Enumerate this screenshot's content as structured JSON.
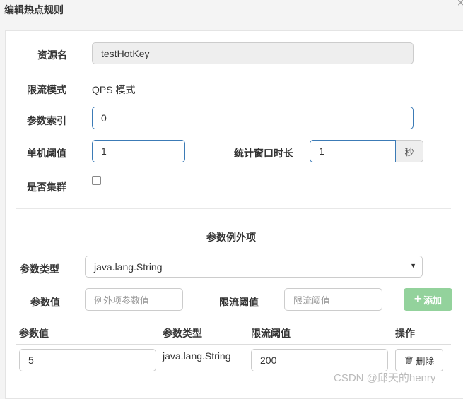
{
  "dialog": {
    "title": "编辑热点规则",
    "close": "×"
  },
  "form": {
    "resource_label": "资源名",
    "resource_value": "testHotKey",
    "mode_label": "限流模式",
    "mode_value": "QPS 模式",
    "param_index_label": "参数索引",
    "param_index_value": "0",
    "threshold_label": "单机阈值",
    "threshold_value": "1",
    "window_label": "统计窗口时长",
    "window_value": "1",
    "window_unit": "秒",
    "cluster_label": "是否集群",
    "cluster_checked": false
  },
  "exceptions": {
    "section_title": "参数例外项",
    "type_label": "参数类型",
    "type_value": "java.lang.String",
    "value_label": "参数值",
    "value_placeholder": "例外项参数值",
    "limit_label": "限流阈值",
    "limit_placeholder": "限流阈值",
    "add_button": "添加"
  },
  "table": {
    "headers": [
      "参数值",
      "参数类型",
      "限流阈值",
      "操作"
    ],
    "rows": [
      {
        "value": "5",
        "type": "java.lang.String",
        "limit": "200",
        "action": "删除"
      }
    ]
  },
  "watermark": "CSDN @邱天的henry"
}
